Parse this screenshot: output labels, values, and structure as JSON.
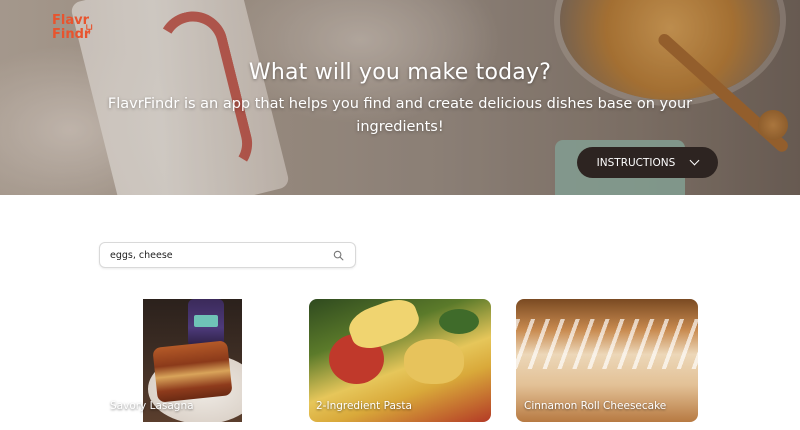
{
  "brand": {
    "logo_line1": "Flavr",
    "logo_line2": "Findr",
    "accent_color": "#e8542e"
  },
  "hero": {
    "title": "What will you make today?",
    "subtitle": "FlavrFindr is an app that helps you find and create delicious dishes base on your ingredients!",
    "instructions_label": "INSTRUCTIONS",
    "instructions_icon": "chevron-down-icon"
  },
  "search": {
    "value": "eggs, cheese",
    "icon": "search-icon"
  },
  "recipes": [
    {
      "title": "Savory Lasagna"
    },
    {
      "title": "2-Ingredient Pasta"
    },
    {
      "title": "Cinnamon Roll Cheesecake"
    }
  ]
}
